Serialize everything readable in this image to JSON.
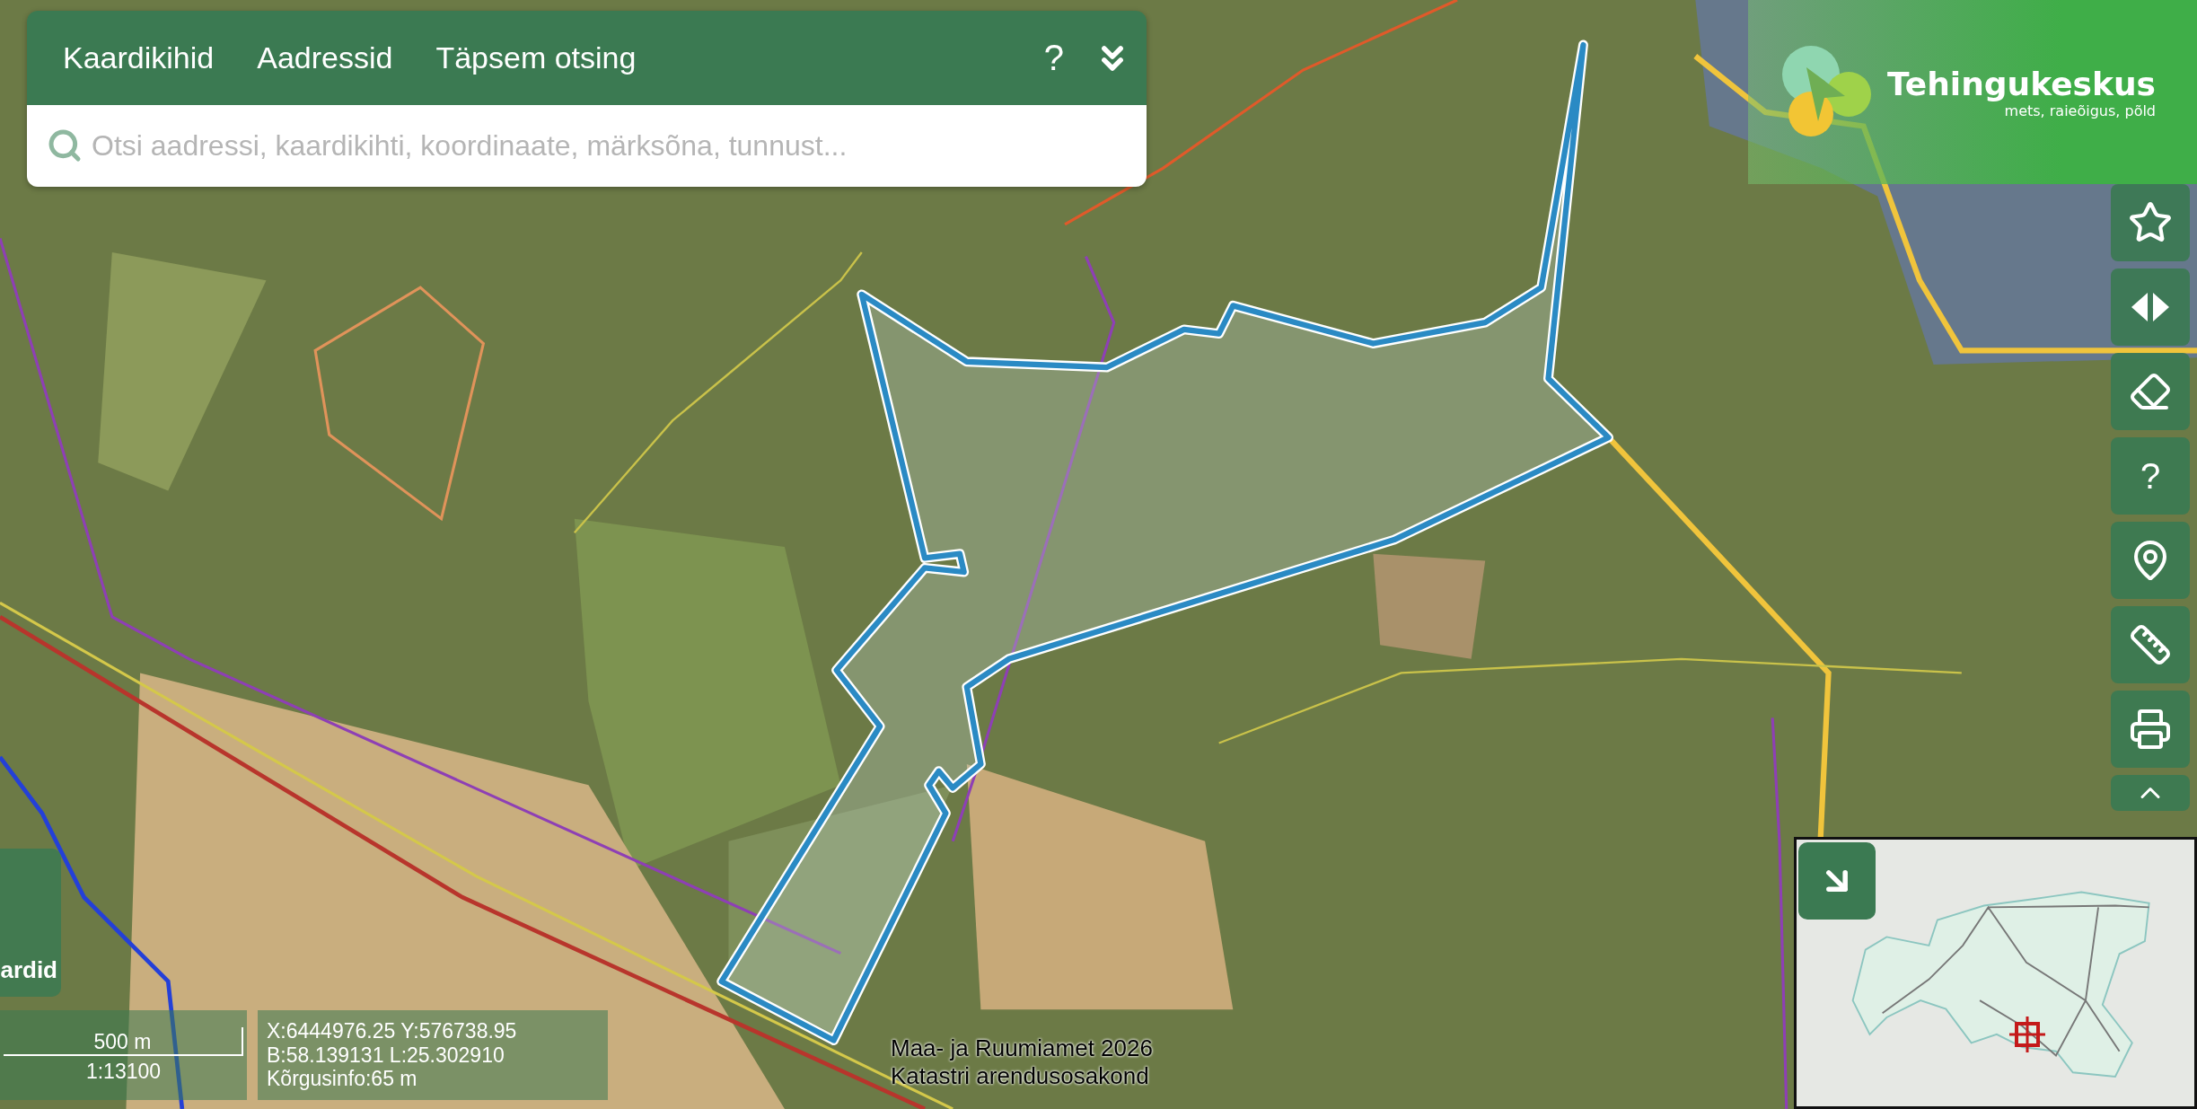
{
  "search_panel": {
    "tabs": [
      {
        "label": "Kaardikihid"
      },
      {
        "label": "Aadressid"
      },
      {
        "label": "Täpsem otsing"
      }
    ],
    "help": "?",
    "search": {
      "placeholder": "Otsi aadressi, kaardikihti, koordinaate, märksõna, tunnust..."
    }
  },
  "logo": {
    "name": "Tehingukeskus",
    "tagline": "mets, raieõigus, põld"
  },
  "toolbar": [
    {
      "kind": "star"
    },
    {
      "kind": "compare"
    },
    {
      "kind": "eraser"
    },
    {
      "kind": "help",
      "label": "?"
    },
    {
      "kind": "pin"
    },
    {
      "kind": "ruler"
    },
    {
      "kind": "print"
    },
    {
      "kind": "collapse"
    }
  ],
  "side_tab": {
    "label": "ardid"
  },
  "scale": {
    "distance": "500 m",
    "ratio": "1:13100"
  },
  "coordinates": [
    "X:6444976.25 Y:576738.95",
    "B:58.139131 L:25.302910",
    "Kõrgusinfo:65 m"
  ],
  "attribution": [
    "Maa- ja Ruumiamet 2026",
    "Katastri arendusosakond"
  ]
}
